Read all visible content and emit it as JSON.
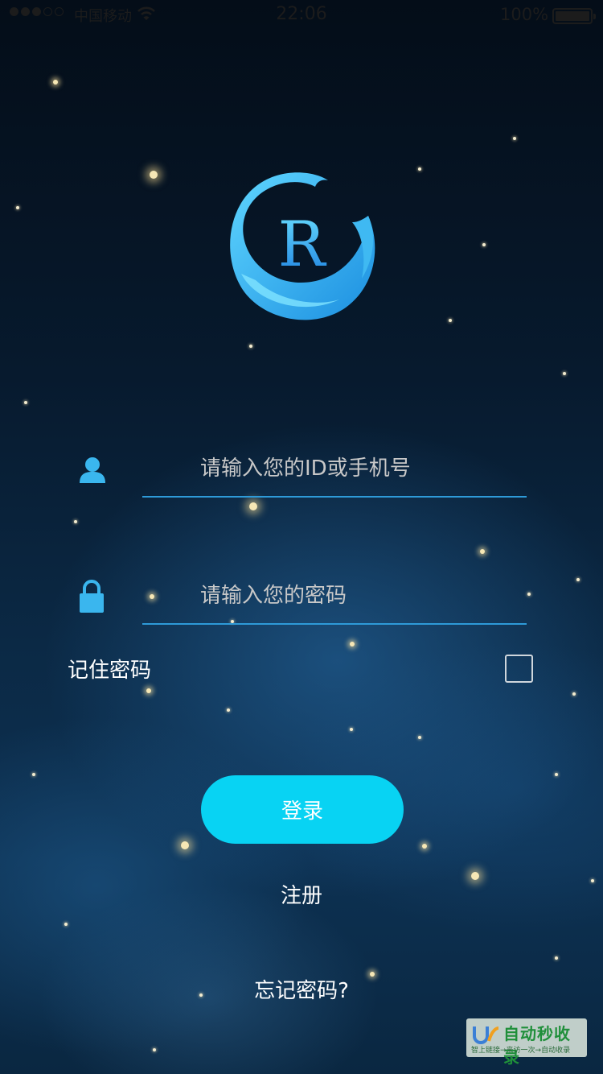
{
  "status_bar": {
    "carrier": "中国移动",
    "time": "22:06",
    "battery": "100%"
  },
  "logo": {
    "letter": "R"
  },
  "login_form": {
    "account_placeholder": "请输入您的ID或手机号",
    "password_placeholder": "请输入您的密码",
    "remember_label": "记住密码",
    "remember_checked": false,
    "login_label": "登录",
    "register_label": "注册",
    "forgot_label": "忘记密码?"
  },
  "icons": {
    "account": "user-icon",
    "password": "lock-icon"
  },
  "colors": {
    "accent": "#08d3f3",
    "field_underline": "#2e9ad8",
    "logo_blue": "#2bb8f0"
  },
  "watermark": {
    "text": "自动秒收录",
    "subtext": "智上链接→来访一次→自动收录"
  }
}
